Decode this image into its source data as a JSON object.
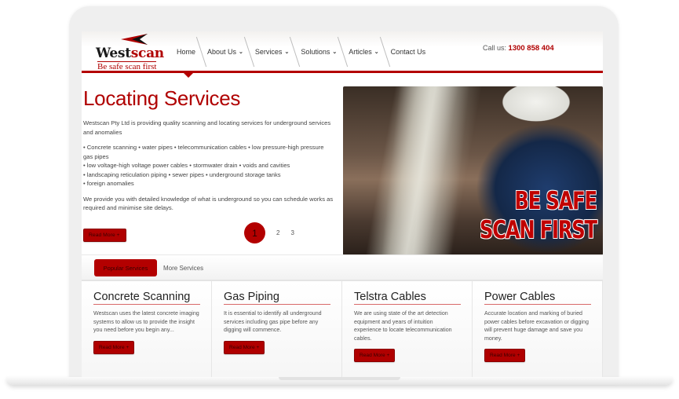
{
  "header": {
    "logo": {
      "word_dark": "West",
      "word_red": "scan",
      "tagline": "Be safe scan first"
    },
    "nav": [
      {
        "label": "Home",
        "dropdown": false
      },
      {
        "label": "About Us",
        "dropdown": true
      },
      {
        "label": "Services",
        "dropdown": true
      },
      {
        "label": "Solutions",
        "dropdown": true
      },
      {
        "label": "Articles",
        "dropdown": true
      },
      {
        "label": "Contact Us",
        "dropdown": false
      }
    ],
    "call_label": "Call us:",
    "phone": "1300 858 404",
    "chevron_glyph": "❯"
  },
  "intro": {
    "title": "Locating Services",
    "paragraph1": "Westscan Pty Ltd is providing quality scanning and locating services for underground services and anomalies",
    "bullets": [
      "• Concrete scanning • water pipes • telecommunication cables • low pressure-high pressure gas pipes",
      "• low voltage-high voltage power cables • stormwater drain • voids and cavities",
      "• landscaping reticulation piping • sewer pipes • underground storage tanks",
      "• foreign anomalies"
    ],
    "paragraph2": "We provide you with detailed knowledge of what is underground so you can schedule works as required and minimise site delays.",
    "read_more": "Read More +"
  },
  "pager": {
    "current": "1",
    "pages": [
      "2",
      "3"
    ]
  },
  "hero": {
    "line1": "BE SAFE",
    "line2": "SCAN FIRST"
  },
  "tabs": {
    "active": "Popular Services",
    "other": "More Services"
  },
  "cards": [
    {
      "title": "Concrete Scanning",
      "text": "Westscan uses the latest concrete imaging systems to allow us to provide the insight you need before you begin any...",
      "button": "Read More +"
    },
    {
      "title": "Gas Piping",
      "text": "It is essential to identify all underground services including gas pipe before any digging will commence.",
      "button": "Read More +"
    },
    {
      "title": "Telstra Cables",
      "text": "We are using state of the art detection equipment and years of intuition experience to locate telecommunication cables.",
      "button": "Read More +"
    },
    {
      "title": "Power Cables",
      "text": "Accurate location and marking of buried power cables before excavation or digging will prevent huge damage and save you money.",
      "button": "Read More +"
    }
  ],
  "colors": {
    "brand_red": "#b00000",
    "text": "#444444"
  }
}
